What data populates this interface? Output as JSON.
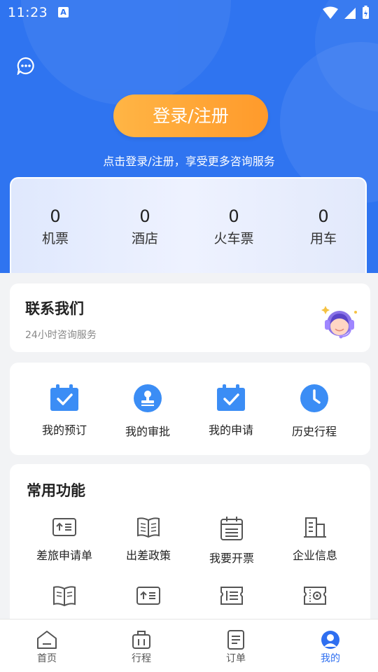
{
  "status_bar": {
    "time": "11:23",
    "app_icon_letter": "A"
  },
  "header": {
    "login_label": "登录/注册",
    "login_tip": "点击登录/注册，享受更多咨询服务"
  },
  "stats": [
    {
      "value": "0",
      "label": "机票"
    },
    {
      "value": "0",
      "label": "酒店"
    },
    {
      "value": "0",
      "label": "火车票"
    },
    {
      "value": "0",
      "label": "用车"
    }
  ],
  "contact": {
    "title": "联系我们",
    "subtitle": "24小时咨询服务"
  },
  "my_items": [
    {
      "label": "我的预订",
      "icon": "calendar-check-icon"
    },
    {
      "label": "我的审批",
      "icon": "stamp-icon"
    },
    {
      "label": "我的申请",
      "icon": "calendar-check-icon"
    },
    {
      "label": "历史行程",
      "icon": "clock-icon"
    }
  ],
  "common": {
    "title": "常用功能",
    "items": [
      {
        "label": "差旅申请单",
        "icon": "form-upload-icon"
      },
      {
        "label": "出差政策",
        "icon": "book-icon"
      },
      {
        "label": "我要开票",
        "icon": "invoice-calendar-icon"
      },
      {
        "label": "企业信息",
        "icon": "building-icon"
      },
      {
        "label": "",
        "icon": "book-icon"
      },
      {
        "label": "",
        "icon": "form-upload-icon"
      },
      {
        "label": "",
        "icon": "ticket-list-icon"
      },
      {
        "label": "",
        "icon": "ticket-settings-icon"
      }
    ]
  },
  "tabs": [
    {
      "label": "首页",
      "icon": "home-icon"
    },
    {
      "label": "行程",
      "icon": "luggage-icon"
    },
    {
      "label": "订单",
      "icon": "order-list-icon"
    },
    {
      "label": "我的",
      "icon": "user-icon",
      "active": true
    }
  ],
  "colors": {
    "primary": "#2f74f0",
    "accent": "#ff9a2b"
  }
}
